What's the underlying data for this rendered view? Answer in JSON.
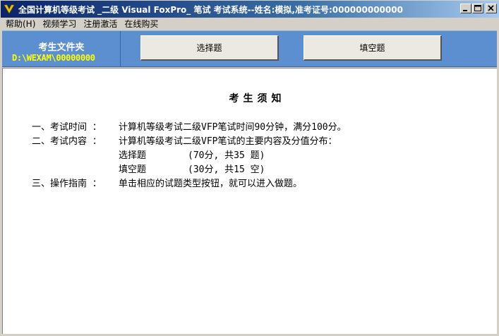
{
  "window": {
    "title": "全国计算机等级考试 _二级 Visual FoxPro_ 笔试 考试系统--姓名:模拟,准考证号:000000000000"
  },
  "menu": {
    "items": [
      {
        "label": "帮助(H)"
      },
      {
        "label": "视频学习"
      },
      {
        "label": "注册激活"
      },
      {
        "label": "在线购买"
      }
    ]
  },
  "header": {
    "folder_label": "考生文件夹",
    "folder_path": "D:\\WEXAM\\00000000",
    "btn_choice": "选择题",
    "btn_fill": "填空题"
  },
  "notice": {
    "title": "考生须知",
    "item1_label": "一、考试时间 ：",
    "item1_text": "计算机等级考试二级VFP笔试时间90分钟，满分100分。",
    "item2_label": "二、考试内容 ：",
    "item2_text": "计算机等级考试二级VFP笔试的主要内容及分值分布：",
    "sub1_name": "选择题",
    "sub1_score": "(70分, 共35 题)",
    "sub2_name": "填空题",
    "sub2_score": "(30分, 共15 空)",
    "item3_label": "三、操作指南 ：",
    "item3_text": "单击相应的试题类型按钮，就可以进入做题。"
  },
  "colors": {
    "titlebar_start": "#0a246a",
    "titlebar_end": "#a6caf0",
    "header_bg": "#5b8fcf",
    "folder_path": "#ffff00"
  }
}
